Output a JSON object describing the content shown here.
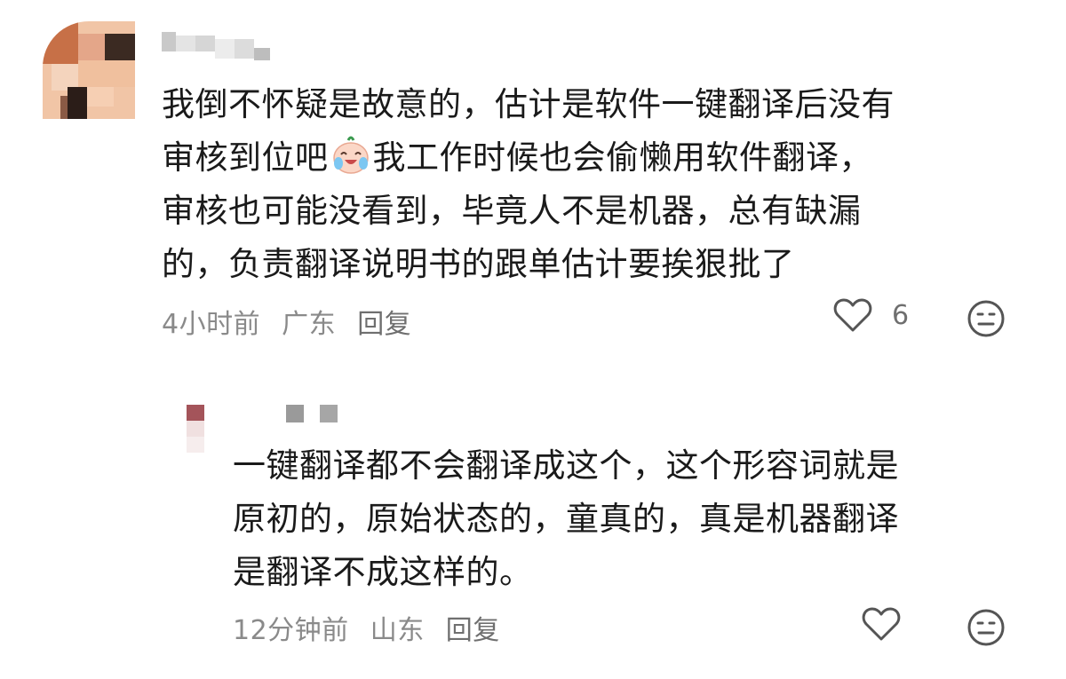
{
  "comments": [
    {
      "username": "",
      "text_lines": [
        "我倒不怀疑是故意的，估计是软件一键翻译后没有",
        "审核到位吧",
        "我工作时候也会偷懒用软件翻译，",
        "审核也可能没看到，毕竟人不是机器，总有缺漏",
        "的，负责翻译说明书的跟单估计要挨狠批了"
      ],
      "emoji_icon": "crying-laughing-emoji-icon",
      "time": "4小时前",
      "location": "广东",
      "reply_label": "回复",
      "like_count": "6",
      "like_icon": "heart-outline-icon",
      "reaction_icon": "neutral-face-icon"
    },
    {
      "username": "",
      "text_lines": [
        "一键翻译都不会翻译成这个，这个形容词就是",
        "原初的，原始状态的，童真的，真是机器翻译",
        "是翻译不成这样的。"
      ],
      "time": "12分钟前",
      "location": "山东",
      "reply_label": "回复",
      "like_count": "",
      "like_icon": "heart-outline-icon",
      "reaction_icon": "neutral-face-icon"
    }
  ],
  "colors": {
    "text": "#1a1a1a",
    "meta": "#8a8a8a",
    "icon": "#555555"
  }
}
